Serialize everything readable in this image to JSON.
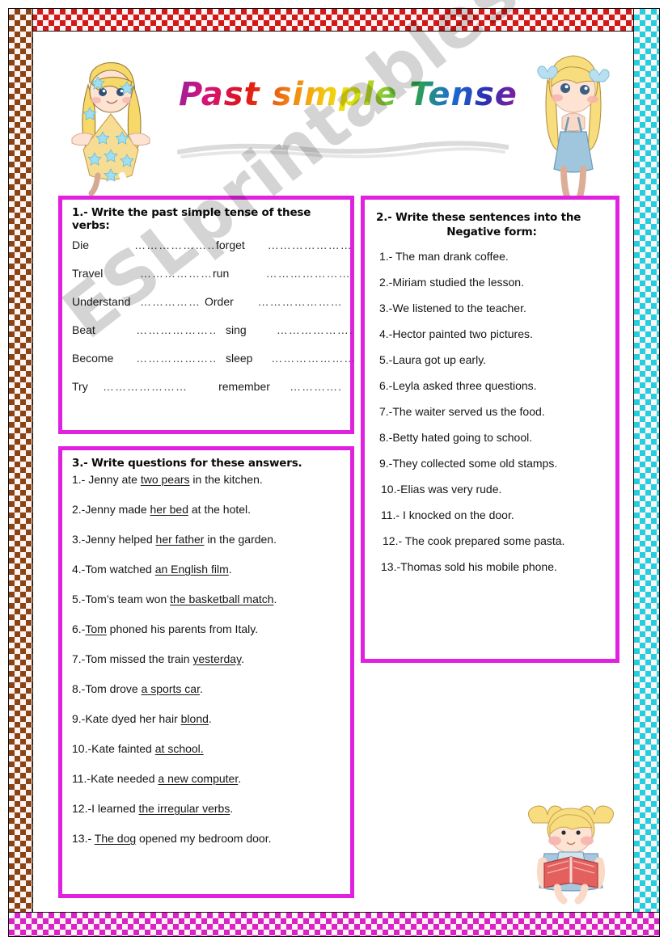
{
  "title": "Past simple Tense",
  "watermark": "ESLprintables.com",
  "border_colors": {
    "top": "#d21919",
    "left": "#8a4414",
    "right": "#22cfe0",
    "bottom": "#da22c8",
    "box": "#e022e0"
  },
  "illustrations": [
    {
      "name": "girl-star-dress",
      "description": "blonde girl in yellow star dress with blue stars"
    },
    {
      "name": "girl-shy-blue-dress",
      "description": "blonde girl with pigtails and blue bows, hands on face"
    },
    {
      "name": "girl-reading-book",
      "description": "blonde girl reading a red book"
    }
  ],
  "exercise1": {
    "heading": "1.- Write the past simple tense of these verbs:",
    "rows": [
      {
        "left_verb": "Die",
        "left_dots": "………………….",
        "right_verb": "forget",
        "right_dots": "…………………."
      },
      {
        "left_verb": "Travel",
        "left_dots": "………………",
        "right_verb": "run",
        "right_dots": "…………………"
      },
      {
        "left_verb": "Understand",
        "left_dots": "……………",
        "right_verb": "Order",
        "right_dots": "…………………"
      },
      {
        "left_verb": "Beat",
        "left_dots": "…………………",
        "right_verb": "sing",
        "right_dots": "……………….."
      },
      {
        "left_verb": "Become",
        "left_dots": "…………………",
        "right_verb": "sleep",
        "right_dots": "…………………"
      },
      {
        "left_verb": "Try",
        "left_dots": "…………………",
        "right_verb": "remember",
        "right_dots": "…………."
      }
    ]
  },
  "exercise2": {
    "heading_line1": "2.- Write these sentences into the",
    "heading_line2": "Negative form:",
    "items": [
      "1.- The man drank coffee.",
      "2.-Miriam studied the lesson.",
      "3.-We listened to the teacher.",
      "4.-Hector painted two pictures.",
      "5.-Laura got up early.",
      "6.-Leyla asked three questions.",
      "7.-The waiter served us the food.",
      "8.-Betty hated going to school.",
      "9.-They collected some old stamps.",
      "10.-Elias was very rude.",
      "11.- I knocked on the door.",
      "12.- The cook prepared some pasta.",
      "13.-Thomas sold his mobile phone."
    ]
  },
  "exercise3": {
    "heading": "3.- Write questions for these answers.",
    "items": [
      {
        "pre": "1.- Jenny ate ",
        "underline": "two pears",
        "post": " in the kitchen."
      },
      {
        "pre": "2.-Jenny made ",
        "underline": "her bed",
        "post": " at the hotel."
      },
      {
        "pre": "3.-Jenny  helped ",
        "underline": "her father",
        "post": " in the garden."
      },
      {
        "pre": "4.-Tom watched ",
        "underline": "an English film",
        "post": "."
      },
      {
        "pre": "5.-Tom’s team won ",
        "underline": "the basketball match",
        "post": "."
      },
      {
        "pre": "6.-",
        "underline": "Tom",
        "post": " phoned his parents from Italy."
      },
      {
        "pre": "7.-Tom missed the train ",
        "underline": "yesterday",
        "post": "."
      },
      {
        "pre": "8.-Tom drove ",
        "underline": "a sports car",
        "post": "."
      },
      {
        "pre": "9.-Kate dyed her hair ",
        "underline": "blond",
        "post": "."
      },
      {
        "pre": "10.-Kate fainted ",
        "underline": "at school.",
        "post": ""
      },
      {
        "pre": "11.-Kate needed ",
        "underline": "a new computer",
        "post": "."
      },
      {
        "pre": "12.-I learned ",
        "underline": "the irregular verbs",
        "post": "."
      },
      {
        "pre": "13.- ",
        "underline": "The dog",
        "post": " opened my bedroom door."
      }
    ]
  }
}
